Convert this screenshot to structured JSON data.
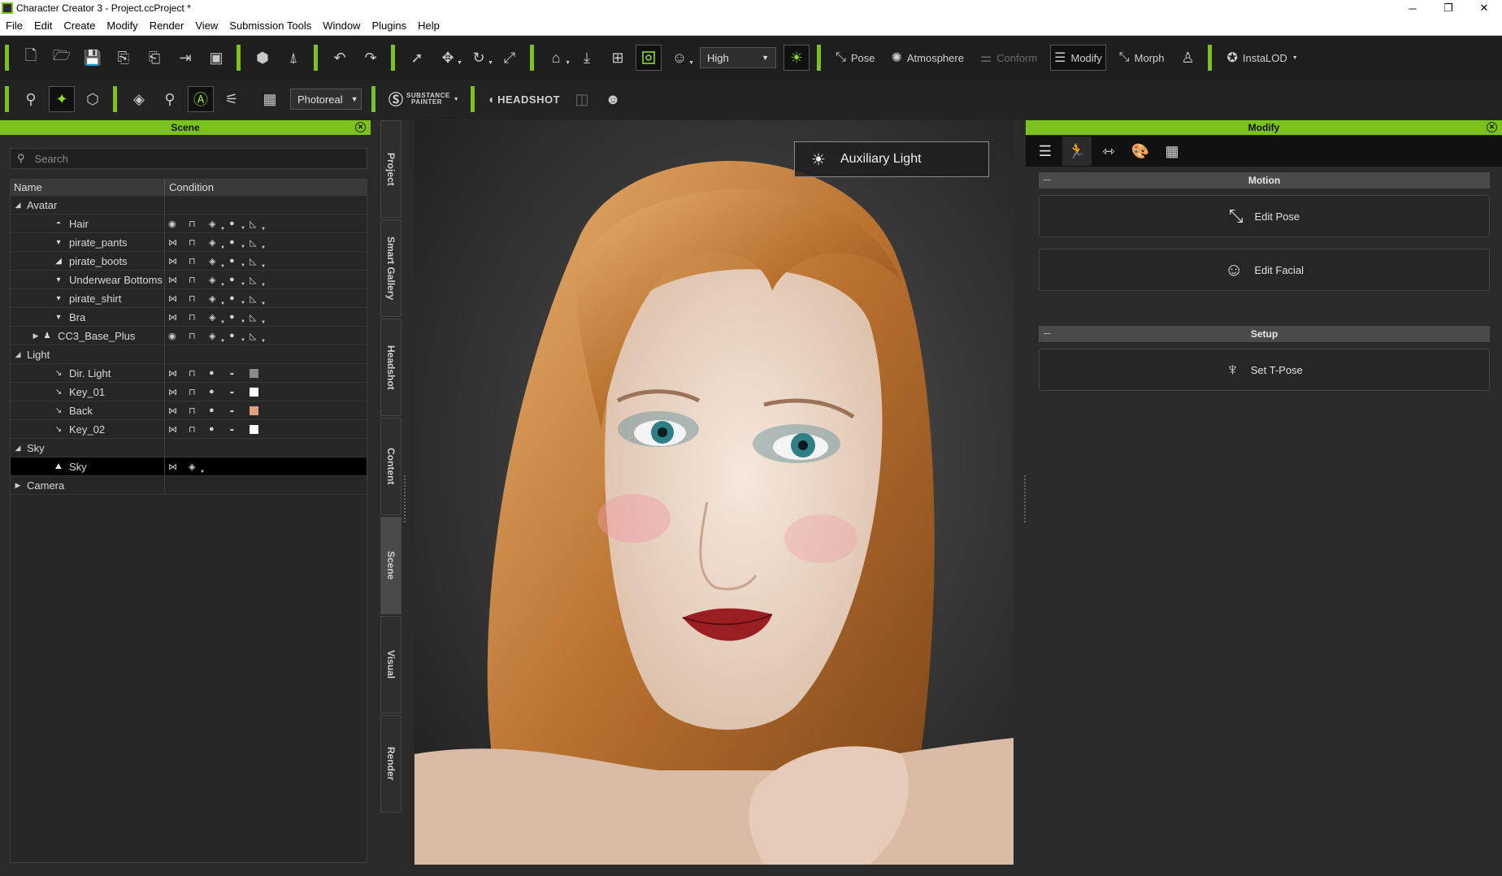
{
  "window": {
    "title": "Character Creator 3 - Project.ccProject *",
    "minimize": "─",
    "maximize": "❐",
    "close": "✕"
  },
  "menu": [
    "File",
    "Edit",
    "Create",
    "Modify",
    "Render",
    "View",
    "Submission Tools",
    "Window",
    "Plugins",
    "Help"
  ],
  "toolbar1": {
    "quality_select": "High",
    "pose_label": "Pose",
    "atmosphere_label": "Atmosphere",
    "conform_label": "Conform",
    "modify_label": "Modify",
    "morph_label": "Morph",
    "instalod_label": "InstaLOD"
  },
  "toolbar2": {
    "render_mode_select": "Photoreal",
    "substance_label_top": "SUBSTANCE",
    "substance_label_bottom": "PAINTER",
    "headshot_label": "HEADSHOT"
  },
  "scene": {
    "title": "Scene",
    "search_placeholder": "Search",
    "col_name": "Name",
    "col_condition": "Condition",
    "rows": [
      {
        "label": "Avatar",
        "level": 0,
        "expander": "◢",
        "icon": "",
        "cond": "none"
      },
      {
        "label": "Hair",
        "level": 2,
        "expander": "",
        "icon": "hair-icon",
        "cond": "avatar-visible"
      },
      {
        "label": "pirate_pants",
        "level": 2,
        "expander": "",
        "icon": "cloth-icon",
        "cond": "avatar"
      },
      {
        "label": "pirate_boots",
        "level": 2,
        "expander": "",
        "icon": "boot-icon",
        "cond": "avatar"
      },
      {
        "label": "Underwear Bottoms",
        "level": 2,
        "expander": "",
        "icon": "cloth-icon",
        "cond": "avatar"
      },
      {
        "label": "pirate_shirt",
        "level": 2,
        "expander": "",
        "icon": "cloth-icon",
        "cond": "avatar"
      },
      {
        "label": "Bra",
        "level": 2,
        "expander": "",
        "icon": "cloth-icon",
        "cond": "avatar"
      },
      {
        "label": "CC3_Base_Plus",
        "level": 1,
        "expander": "▶",
        "icon": "person-icon",
        "cond": "avatar-visible"
      },
      {
        "label": "Light",
        "level": 0,
        "expander": "◢",
        "icon": "",
        "cond": "none"
      },
      {
        "label": "Dir. Light",
        "level": 2,
        "expander": "",
        "icon": "light-icon",
        "cond": "light",
        "swatch": "#8a8a8a"
      },
      {
        "label": "Key_01",
        "level": 2,
        "expander": "",
        "icon": "light-icon",
        "cond": "light",
        "swatch": "#ffffff"
      },
      {
        "label": "Back",
        "level": 2,
        "expander": "",
        "icon": "light-icon",
        "cond": "light",
        "swatch": "#e0a080"
      },
      {
        "label": "Key_02",
        "level": 2,
        "expander": "",
        "icon": "light-icon",
        "cond": "light",
        "swatch": "#ffffff"
      },
      {
        "label": "Sky",
        "level": 0,
        "expander": "◢",
        "icon": "",
        "cond": "none"
      },
      {
        "label": "Sky",
        "level": 2,
        "expander": "",
        "icon": "sky-icon",
        "cond": "sky",
        "selected": true
      },
      {
        "label": "Camera",
        "level": 0,
        "expander": "▶",
        "icon": "",
        "cond": "none"
      }
    ]
  },
  "side_tabs": [
    "Project",
    "Smart Gallery",
    "Headshot",
    "Content",
    "Scene",
    "Visual",
    "Render"
  ],
  "side_tab_active": "Scene",
  "viewport": {
    "badge_label": "Auxiliary Light"
  },
  "modify": {
    "title": "Modify",
    "sections": {
      "motion": "Motion",
      "setup": "Setup"
    },
    "buttons": {
      "edit_pose": "Edit Pose",
      "edit_facial": "Edit Facial",
      "set_tpose": "Set T-Pose"
    }
  },
  "colors": {
    "accent": "#7cc21e",
    "panel_bg": "#2a2a2a",
    "toolbar_bg": "#1e1e1e"
  }
}
